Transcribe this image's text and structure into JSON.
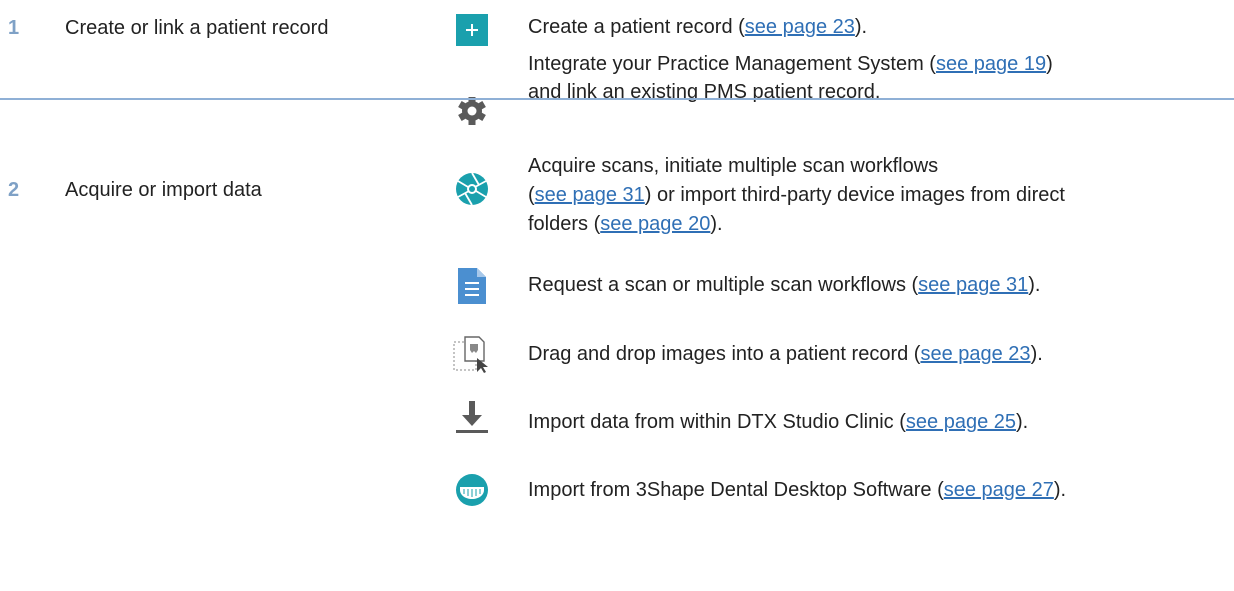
{
  "steps": [
    {
      "number": "1",
      "title": "Create or link a patient record",
      "actions": [
        {
          "icon": "plus-icon",
          "before": "Create a patient record (",
          "link": "see page 23",
          "after": ")."
        },
        {
          "icon": "gear-icon",
          "before": "Integrate your Practice Management System (",
          "link": "see page 19",
          "after": ")",
          "line2": "and link an existing PMS patient record."
        }
      ]
    },
    {
      "number": "2",
      "title": "Acquire or import data",
      "actions": [
        {
          "icon": "aperture-icon",
          "line1": "Acquire scans, initiate multiple scan workflows",
          "l2_before": "(",
          "l2_link": "see page 31",
          "l2_after": ") or import third-party device images from direct",
          "l3_before": "folders (",
          "l3_link": "see page 20",
          "l3_after": ")."
        },
        {
          "icon": "document-icon",
          "before": "Request a scan or multiple scan workflows (",
          "link": "see page 31",
          "after": ")."
        },
        {
          "icon": "drag-drop-icon",
          "before": "Drag and drop images into a patient record (",
          "link": "see page 23",
          "after": ")."
        },
        {
          "icon": "download-icon",
          "before": "Import data from within DTX Studio Clinic (",
          "link": "see page 25",
          "after": ")."
        },
        {
          "icon": "dental-scan-icon",
          "before": "Import from 3Shape Dental Desktop Software (",
          "link": "see page 27",
          "after": ")."
        }
      ]
    }
  ],
  "colors": {
    "accent": "#1aa0ad",
    "link": "#2f6fb5",
    "number": "#7fa1c6",
    "separator": "#8fb0d6",
    "icon_gray": "#5a5a5a"
  }
}
